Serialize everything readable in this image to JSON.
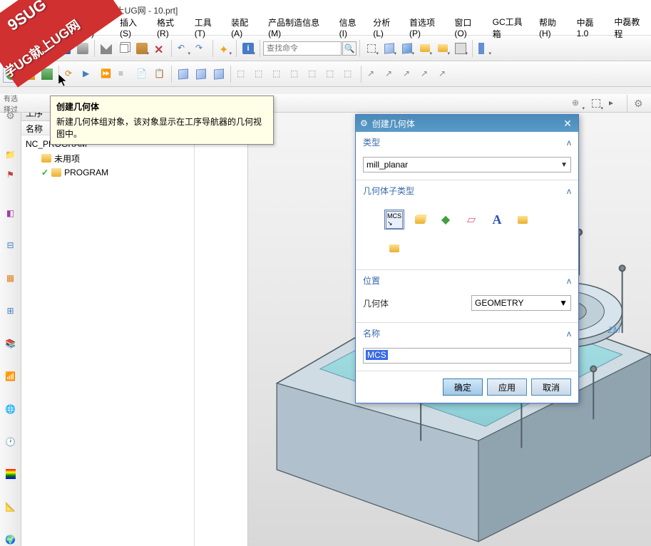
{
  "title": " - [学UG就上UG网 - 10.prt]",
  "watermark": {
    "top": "9SUG",
    "mid": "学UG就上UG网"
  },
  "menu": [
    "视图(V)",
    "插入(S)",
    "格式(R)",
    "工具(T)",
    "装配(A)",
    "产品制造信息(M)",
    "信息(I)",
    "分析(L)",
    "首选项(P)",
    "窗口(O)",
    "GC工具箱",
    "帮助(H)",
    "中磊1.0",
    "中磊教程"
  ],
  "search_placeholder": "查找命令",
  "tooltip": {
    "title": "创建几何体",
    "body": "新建几何体组对象，该对象显示在工序导航器的几何视图中。"
  },
  "nav": {
    "tab": "工序",
    "col": "名称",
    "rows": [
      {
        "label": "NC_PROGRAM",
        "indent": 0,
        "icon": "none"
      },
      {
        "label": "未用项",
        "indent": 1,
        "icon": "folder"
      },
      {
        "label": "PROGRAM",
        "indent": 1,
        "icon": "folder-check"
      }
    ]
  },
  "dialog": {
    "title": "创建几何体",
    "gear": "⚙",
    "sections": {
      "type": "类型",
      "subtype": "几何体子类型",
      "location": "位置",
      "name": "名称"
    },
    "type_value": "mill_planar",
    "location_label": "几何体",
    "location_value": "GEOMETRY",
    "name_value": "MCS",
    "buttons": {
      "ok": "确定",
      "apply": "应用",
      "cancel": "取消"
    }
  },
  "axis_label": "ZM"
}
